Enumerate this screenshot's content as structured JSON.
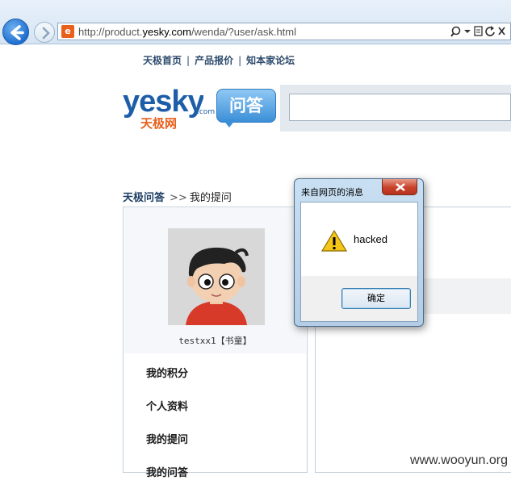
{
  "browser": {
    "url_prefix": "http://product.",
    "url_host": "yesky.com",
    "url_path": "/wenda/?user/ask.html",
    "favicon": "e"
  },
  "topnav": {
    "items": [
      "天极首页",
      "产品报价",
      "知本家论坛"
    ],
    "separator": "|"
  },
  "logo": {
    "brand": "yesky",
    "domain_suffix": ".com",
    "chinese_name": "天极网",
    "product": "问答"
  },
  "breadcrumb": {
    "home": "天极问答",
    "separator": ">>",
    "current": "我的提问"
  },
  "profile": {
    "username": "testxx1",
    "rank": "【书童】"
  },
  "menu": {
    "items": [
      "我的积分",
      "个人资料",
      "我的提问",
      "我的问答"
    ]
  },
  "dialog": {
    "title": "来自网页的消息",
    "message": "hacked",
    "ok_label": "确定"
  },
  "watermark": "www.wooyun.org",
  "colors": {
    "accent_blue": "#1e5ea8",
    "brand_orange": "#e8601c",
    "nav_text": "#2c4a6b"
  }
}
